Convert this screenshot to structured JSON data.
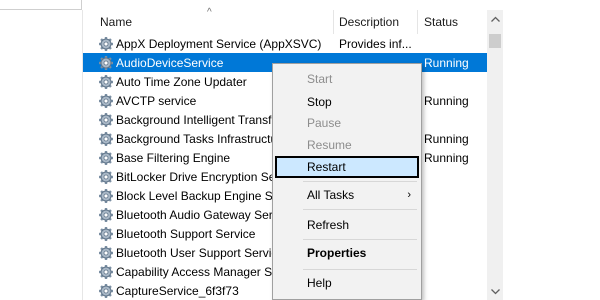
{
  "columns": {
    "name": "Name",
    "description": "Description",
    "status": "Status"
  },
  "services": [
    {
      "name": "AppX Deployment Service (AppXSVC)",
      "description": "Provides inf...",
      "status": ""
    },
    {
      "name": "AudioDeviceService",
      "description": "",
      "status": "Running",
      "selected": true
    },
    {
      "name": "Auto Time Zone Updater",
      "description": "",
      "status": ""
    },
    {
      "name": "AVCTP service",
      "description": "",
      "status": "Running"
    },
    {
      "name": "Background Intelligent Transf",
      "description": "",
      "status": ""
    },
    {
      "name": "Background Tasks Infrastructu",
      "description": "",
      "status": "Running"
    },
    {
      "name": "Base Filtering Engine",
      "description": "",
      "status": "Running"
    },
    {
      "name": "BitLocker Drive Encryption Se",
      "description": "",
      "status": ""
    },
    {
      "name": "Block Level Backup Engine Se",
      "description": "",
      "status": ""
    },
    {
      "name": "Bluetooth Audio Gateway Serv",
      "description": "",
      "status": ""
    },
    {
      "name": "Bluetooth Support Service",
      "description": "",
      "status": ""
    },
    {
      "name": "Bluetooth User Support Servic",
      "description": "",
      "status": ""
    },
    {
      "name": "Capability Access Manager Se",
      "description": "",
      "status": ""
    },
    {
      "name": "CaptureService_6f3f73",
      "description": "",
      "status": ""
    }
  ],
  "context_menu": {
    "items": [
      {
        "label": "Start",
        "disabled": true
      },
      {
        "label": "Stop",
        "disabled": false
      },
      {
        "label": "Pause",
        "disabled": true
      },
      {
        "label": "Resume",
        "disabled": true
      },
      {
        "label": "Restart",
        "disabled": false,
        "highlighted": true
      },
      {
        "label": "All Tasks",
        "disabled": false,
        "submenu": true
      },
      {
        "label": "Refresh",
        "disabled": false
      },
      {
        "label": "Properties",
        "disabled": false,
        "bold": true
      },
      {
        "label": "Help",
        "disabled": false
      }
    ],
    "submenu_arrow": "›"
  },
  "icons": {
    "service_icon": "gear-icon",
    "sort_indicator": "sort-up-icon"
  },
  "colors": {
    "selection": "#0078d7",
    "menu_highlight": "#cce8ff",
    "menu_background": "#f2f2f2"
  }
}
